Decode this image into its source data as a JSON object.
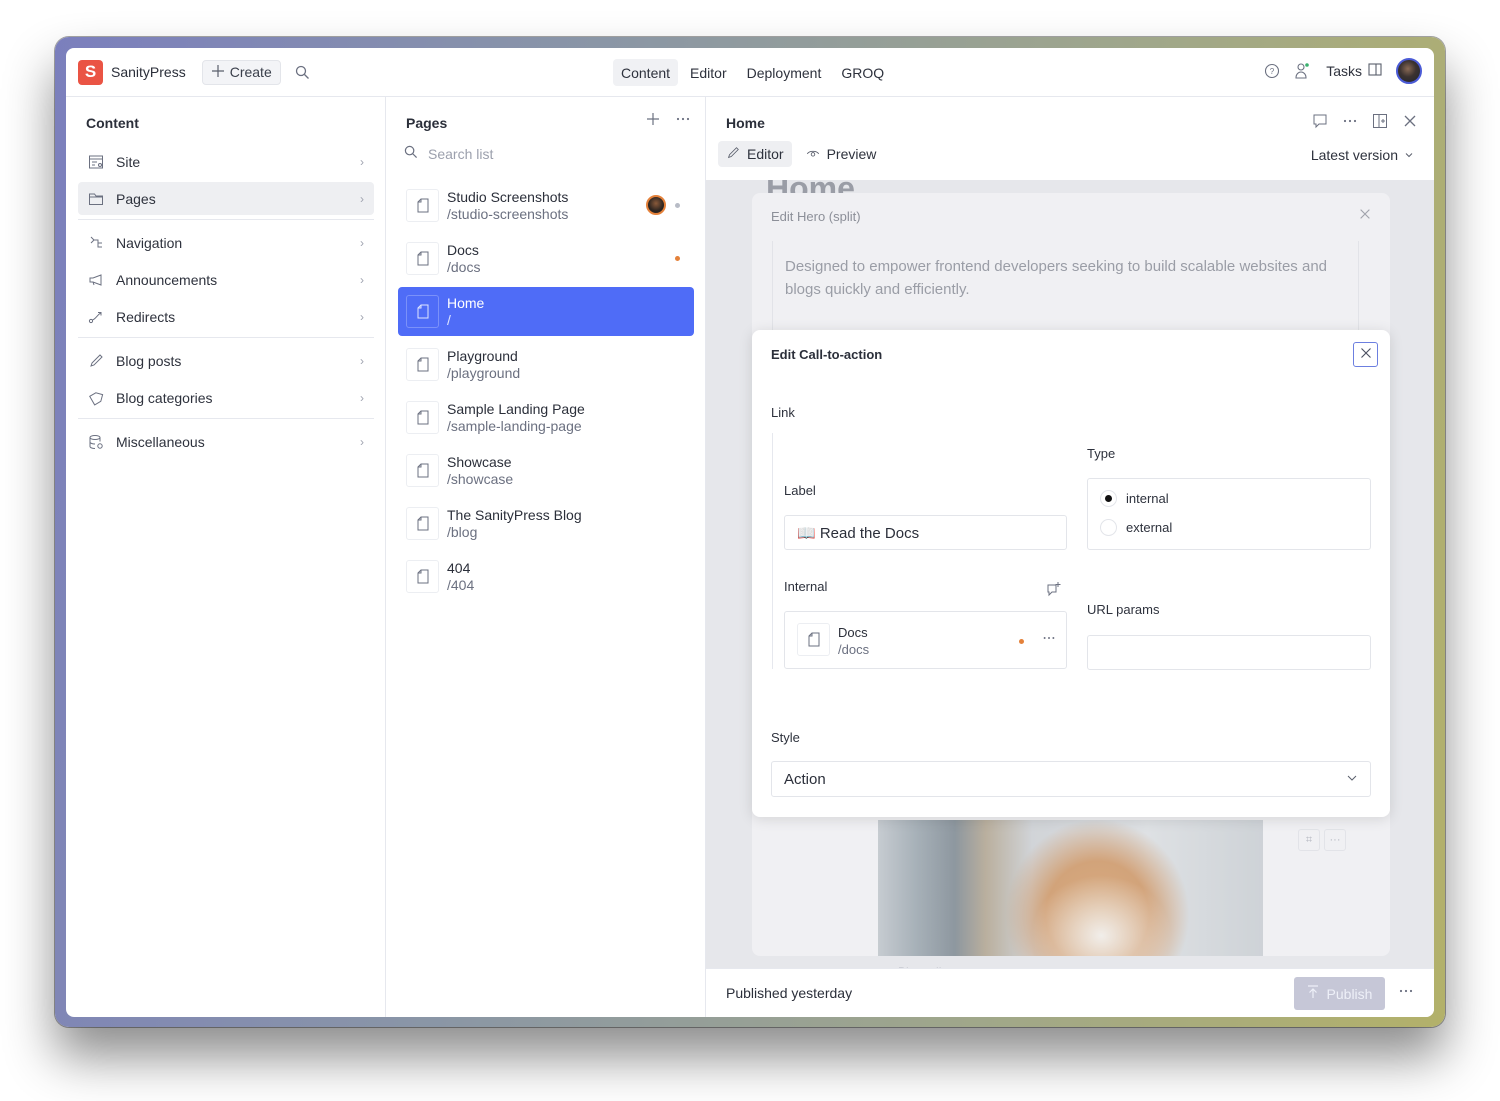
{
  "app": {
    "logo_letter": "S",
    "name": "SanityPress",
    "create_label": "Create",
    "nav_tabs": [
      {
        "label": "Content",
        "active": true
      },
      {
        "label": "Editor",
        "active": false
      },
      {
        "label": "Deployment",
        "active": false
      },
      {
        "label": "GROQ",
        "active": false
      }
    ],
    "tasks_label": "Tasks"
  },
  "structure": {
    "title": "Content",
    "items": [
      {
        "label": "Site",
        "icon": "site-settings-icon"
      },
      {
        "label": "Pages",
        "icon": "folder-icon",
        "active": true
      },
      {
        "label": "Navigation",
        "icon": "navigation-icon"
      },
      {
        "label": "Announcements",
        "icon": "megaphone-icon"
      },
      {
        "label": "Redirects",
        "icon": "redirect-icon"
      },
      {
        "label": "Blog posts",
        "icon": "pencil-icon"
      },
      {
        "label": "Blog categories",
        "icon": "tag-icon"
      },
      {
        "label": "Miscellaneous",
        "icon": "database-icon"
      }
    ]
  },
  "list": {
    "title": "Pages",
    "search_placeholder": "Search list",
    "items": [
      {
        "title": "Studio Screenshots",
        "slug": "/studio-screenshots",
        "status": "gray",
        "has_avatar": true
      },
      {
        "title": "Docs",
        "slug": "/docs",
        "status": "orange"
      },
      {
        "title": "Home",
        "slug": "/",
        "selected": true
      },
      {
        "title": "Playground",
        "slug": "/playground"
      },
      {
        "title": "Sample Landing Page",
        "slug": "/sample-landing-page"
      },
      {
        "title": "Showcase",
        "slug": "/showcase"
      },
      {
        "title": "The SanityPress Blog",
        "slug": "/blog"
      },
      {
        "title": "404",
        "slug": "/404"
      }
    ]
  },
  "document": {
    "title": "Home",
    "tabs": [
      {
        "label": "Editor",
        "active": true
      },
      {
        "label": "Preview",
        "active": false
      }
    ],
    "version_label": "Latest version",
    "ghost_heading": "Home",
    "hero_dialog": {
      "title": "Edit Hero (split)",
      "text": "Designed to empower frontend developers seeking to build scalable websites and blogs quickly and efficiently."
    },
    "blog_rollup_label": "Blog rollup",
    "cta_dialog": {
      "title": "Edit Call-to-action",
      "link_label": "Link",
      "label_field": "Label",
      "label_value": "📖 Read the Docs",
      "type_field": "Type",
      "type_options": [
        "internal",
        "external"
      ],
      "type_selected": "internal",
      "internal_field": "Internal",
      "internal_ref": {
        "title": "Docs",
        "slug": "/docs"
      },
      "url_params_field": "URL params",
      "url_params_value": "",
      "style_field": "Style",
      "style_value": "Action"
    },
    "footer": {
      "status": "Published yesterday",
      "publish_label": "Publish"
    }
  },
  "colors": {
    "brand": "#ea5444",
    "selection": "#4f6cf7",
    "status_orange": "#e4813a",
    "status_gray": "#b8bcc6"
  }
}
